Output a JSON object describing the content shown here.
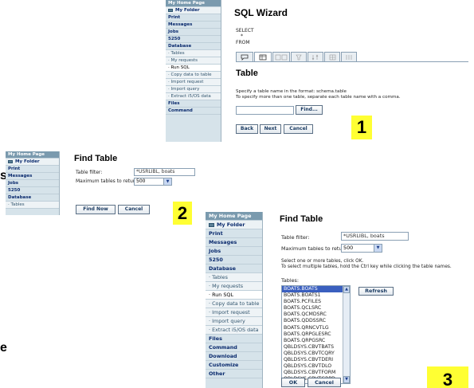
{
  "panel1": {
    "nav": [
      "My Home Page",
      "My Folder",
      "Print",
      "Messages",
      "Jobs",
      "5250",
      "Database",
      "Tables",
      "My requests",
      "Run SQL",
      "Copy data to table",
      "Import request",
      "Import query",
      "Extract i5/OS data",
      "Files",
      "Command"
    ],
    "wizard_title": "SQL Wizard",
    "select_label": "SELECT",
    "select_value": "*",
    "from_label": "FROM",
    "tab_icons": [
      "speech-bubble-icon",
      "table-icon",
      "columns-icon",
      "filter-icon",
      "sort-icon",
      "grid-icon",
      "group-icon"
    ],
    "section_title": "Table",
    "instruction_1": "Specify a table name in the format: schema.table",
    "instruction_2": "To specify more than one table, separate each table name with a comma.",
    "table_input_value": "",
    "find_button": "Find...",
    "back_button": "Back",
    "next_button": "Next",
    "cancel_button": "Cancel",
    "callout": "1"
  },
  "panel2": {
    "nav": [
      "My Home Page",
      "My Folder",
      "Print",
      "Messages",
      "Jobs",
      "5250",
      "Database",
      "Tables"
    ],
    "title": "Find Table",
    "filter_label": "Table filter:",
    "filter_value": "*USRLIBL, boats",
    "max_label": "Maximum tables to return:",
    "max_value": "500",
    "find_now_button": "Find Now",
    "cancel_button": "Cancel",
    "callout": "2"
  },
  "panel3": {
    "nav": [
      "My Home Page",
      "My Folder",
      "Print",
      "Messages",
      "Jobs",
      "5250",
      "Database",
      "Tables",
      "My requests",
      "Run SQL",
      "Copy data to table",
      "Import request",
      "Import query",
      "Extract i5/OS data",
      "Files",
      "Command",
      "Download",
      "Customize",
      "Other"
    ],
    "title": "Find Table",
    "filter_label": "Table filter:",
    "filter_value": "*USRLIBL, boats",
    "max_label": "Maximum tables to return:",
    "max_value": "500",
    "instruction_1": "Select one or more tables, click OK.",
    "instruction_2": "To select multiple tables, hold the Ctrl key while clicking the table names.",
    "tables_label": "Tables:",
    "tables": [
      "BOATS.BOATS",
      "BOATS.BOATS1",
      "BOATS.PCFILES",
      "BOATS.QCLSRC",
      "BOATS.QCMDSRC",
      "BOATS.QDDSSRC",
      "BOATS.QRNCVTLG",
      "BOATS.QRPGLESRC",
      "BOATS.QRPGSRC",
      "QBLDSYS.CBVTBATS",
      "QBLDSYS.CBVTCQRY",
      "QBLDSYS.CBVTDERI",
      "QBLDSYS.CBVTDLO",
      "QBLDSYS.CBVTFORM",
      "QBLDSYS.CBVTGRPD"
    ],
    "refresh_button": "Refresh",
    "ok_button": "OK",
    "cancel_button": "Cancel",
    "callout": "3"
  },
  "edge_fragments": [
    "s",
    "e"
  ]
}
